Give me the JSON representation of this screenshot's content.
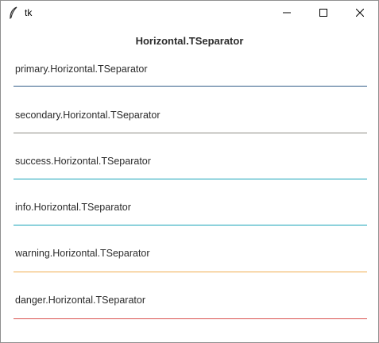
{
  "window": {
    "title": "tk"
  },
  "heading": "Horizontal.TSeparator",
  "separators": [
    {
      "label": "primary.Horizontal.TSeparator",
      "color": "#325d88"
    },
    {
      "label": "secondary.Horizontal.TSeparator",
      "color": "#8e8c84"
    },
    {
      "label": "success.Horizontal.TSeparator",
      "color": "#17a2b8"
    },
    {
      "label": "info.Horizontal.TSeparator",
      "color": "#17a2b8"
    },
    {
      "label": "warning.Horizontal.TSeparator",
      "color": "#f0ad4e"
    },
    {
      "label": "danger.Horizontal.TSeparator",
      "color": "#d9534f"
    }
  ]
}
